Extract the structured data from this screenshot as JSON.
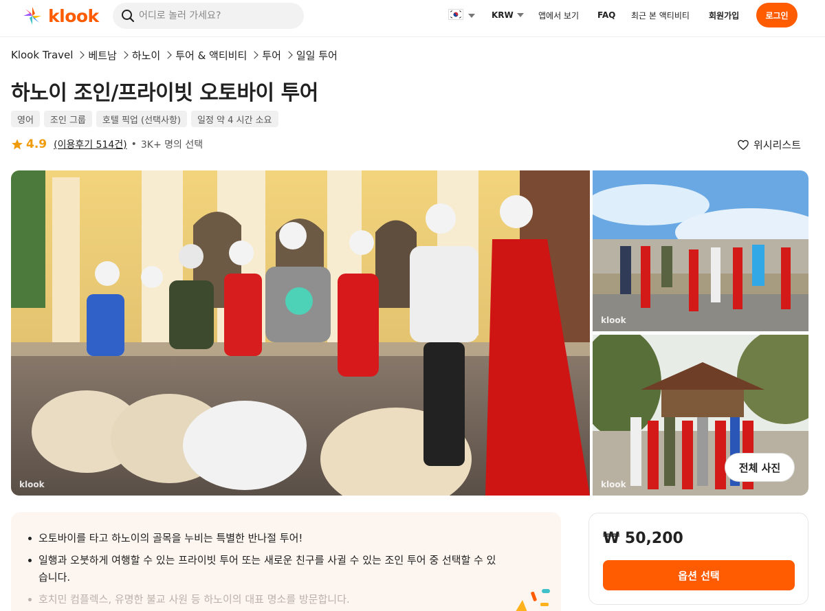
{
  "header": {
    "logo_text": "klook",
    "search_placeholder": "어디로 놀러 가세요?",
    "currency": "KRW",
    "app_link": "앱에서 보기",
    "faq": "FAQ",
    "recent": "최근 본 액티비티",
    "signup": "회원가입",
    "login": "로그인"
  },
  "breadcrumb": [
    "Klook Travel",
    "베트남",
    "하노이",
    "투어 & 액티비티",
    "투어",
    "일일 투어"
  ],
  "title": "하노이 조인/프라이빗 오토바이 투어",
  "tags": [
    "영어",
    "조인 그룹",
    "호텔 픽업 (선택사항)",
    "일정 약 4 시간 소요"
  ],
  "rating": {
    "score": "4.9",
    "reviews": "(이용후기 514건)",
    "booked": "3K+ 명의 선택"
  },
  "wishlist": "위시리스트",
  "gallery": {
    "watermark": "klook",
    "all_photos": "전체 사진"
  },
  "highlights": [
    "오토바이를 타고 하노이의 골목을 누비는 특별한 반나절 투어!",
    "일행과 오붓하게 여행할 수 있는 프라이빗 투어 또는 새로운 친구를 사귈 수 있는 조인 투어 중 선택할 수 있습니다.",
    "호치민 컴플렉스, 유명한 불교 사원 등 하노이의 대표 명소를 방문합니다."
  ],
  "booking": {
    "price": "₩ 50,200",
    "button": "옵션 선택"
  },
  "colors": {
    "brand": "#ff5b00",
    "rating_star": "#f09b0a",
    "highlight_bg": "#fdf5ef"
  }
}
